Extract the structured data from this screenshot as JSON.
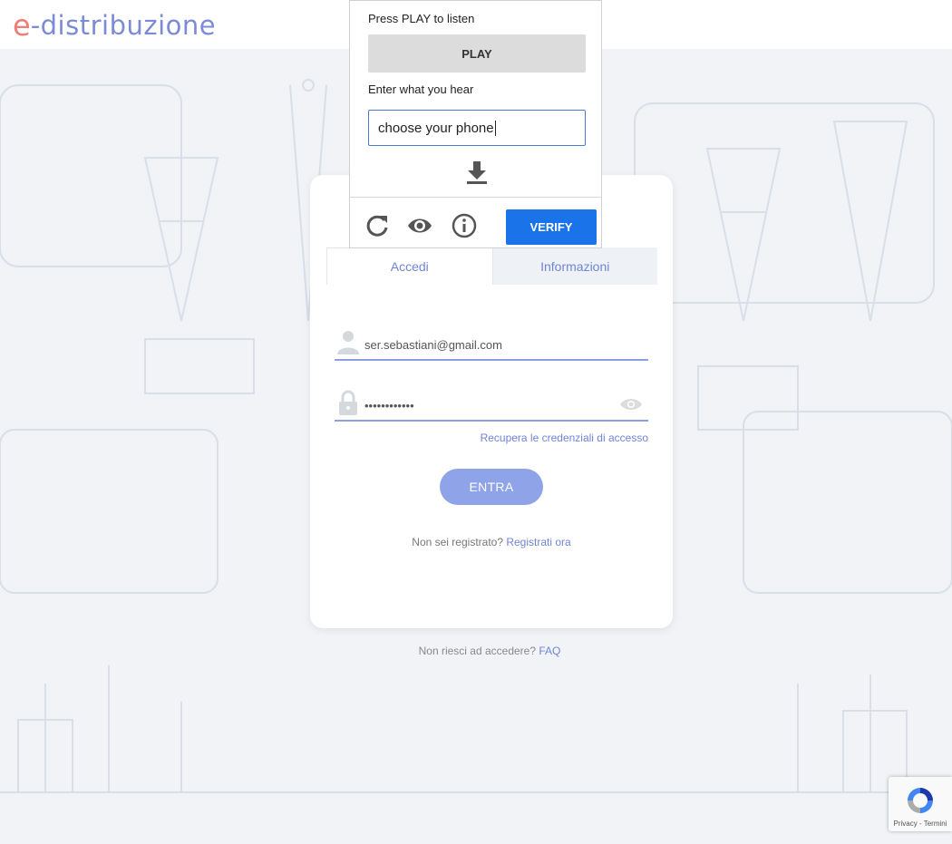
{
  "header": {
    "logo_prefix": "e",
    "logo_text": "-distribuzione"
  },
  "captcha": {
    "instruction_play": "Press PLAY to listen",
    "play_label": "PLAY",
    "instruction_input": "Enter what you hear",
    "input_value": "choose your phone",
    "verify_label": "VERIFY"
  },
  "login": {
    "tabs": [
      {
        "label": "Accedi"
      },
      {
        "label": "Informazioni"
      }
    ],
    "email_value": "ser.sebastiani@gmail.com",
    "password_value": "••••••••••••",
    "recover_label": "Recupera le credenziali di accesso",
    "submit_label": "ENTRA",
    "not_registered": "Non sei registrato?",
    "register_link": "Registrati ora"
  },
  "footer": {
    "help_text": "Non riesci ad accedere?",
    "faq_link": "FAQ"
  },
  "recaptcha": {
    "privacy": "Privacy",
    "terms": "Termini",
    "separator": " - "
  },
  "colors": {
    "accent": "#6f85d6",
    "button": "#8ea3e8",
    "verify": "#1a73e8",
    "logo_e": "#ee7d73"
  }
}
